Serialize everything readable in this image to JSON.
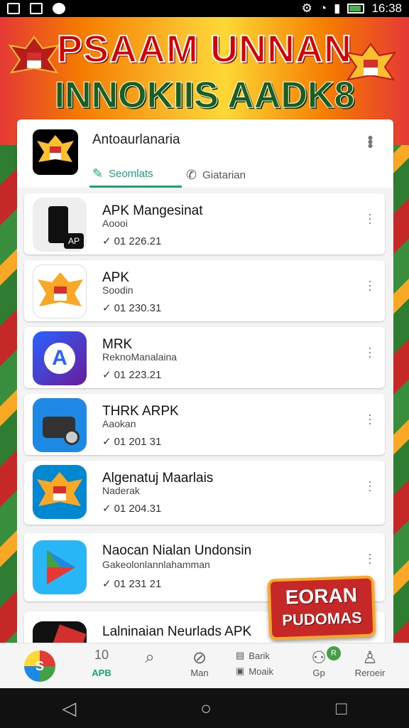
{
  "status_bar": {
    "time": "16:38"
  },
  "banner": {
    "line1": "PSAAM UNNAN",
    "line2": "INNOKIIS AADK8"
  },
  "header": {
    "title": "Antoaurlanaria",
    "tabs": [
      {
        "label": "Seomlats",
        "icon": "pencil-icon"
      },
      {
        "label": "Giatarian",
        "icon": "phone-icon"
      }
    ]
  },
  "apps": [
    {
      "title": "APK Mangesinat",
      "subtitle": "Aoooi",
      "meta": "01 226.21",
      "icon": "phone-device-icon"
    },
    {
      "title": "APK",
      "subtitle": "Soodin",
      "meta": "01 230.31",
      "icon": "garuda-emblem-icon"
    },
    {
      "title": "MRK",
      "subtitle": "ReknoManalaina",
      "meta": "01 223.21",
      "icon": "a-letter-icon"
    },
    {
      "title": "THRK ARPK",
      "subtitle": "Aaokan",
      "meta": "01 201 31",
      "icon": "vehicle-icon"
    },
    {
      "title": "Algenatuj Maarlais",
      "subtitle": "Naderak",
      "meta": "01 204.31",
      "icon": "garuda-emblem-icon"
    },
    {
      "title": "Naocan Nialan Undonsin",
      "subtitle": "Gakeolonlannlahamman",
      "meta": "01 231 21",
      "icon": "play-store-icon"
    },
    {
      "title": "Lalninaian Neurlads APK",
      "subtitle": "",
      "meta": "",
      "icon": "app-icon"
    }
  ],
  "promo": {
    "line1": "EORAN",
    "line2": "PUDOMAS"
  },
  "bottom_nav": {
    "logo_count": "10",
    "logo_label": "APB",
    "items": [
      {
        "label": "",
        "icon": "search-icon"
      },
      {
        "label": "Man",
        "icon": "compass-icon"
      },
      {
        "label": "Barik",
        "label2": "Moaik",
        "icon": "list-icon"
      },
      {
        "label": "Gp",
        "icon": "group-icon"
      },
      {
        "label": "Reroeir",
        "icon": "person-icon"
      }
    ],
    "badge": "R"
  }
}
